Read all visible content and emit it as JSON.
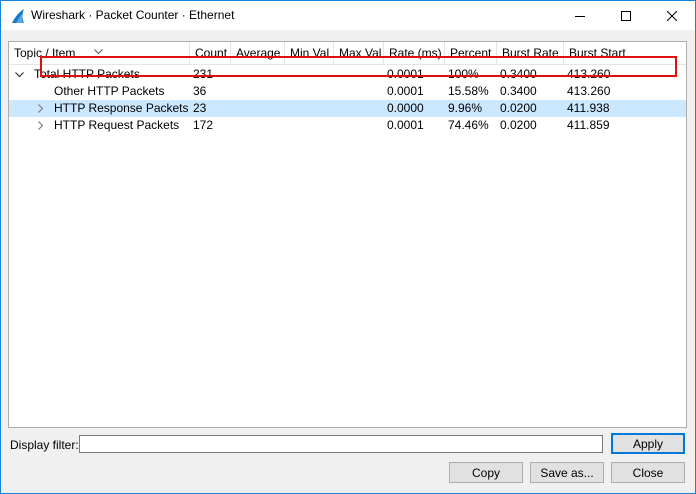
{
  "window": {
    "title": "Wireshark · Packet Counter · Ethernet",
    "accent": "#1883d7"
  },
  "tree": {
    "columns": [
      "Topic / Item",
      "Count",
      "Average",
      "Min Val",
      "Max Val",
      "Rate (ms)",
      "Percent",
      "Burst Rate",
      "Burst Start"
    ],
    "rows": [
      {
        "topic": "Total HTTP Packets",
        "count": "231",
        "average": "",
        "min": "",
        "max": "",
        "rate": "0.0001",
        "percent": "100%",
        "burst_rate": "0.3400",
        "burst_start": "413.260",
        "expander": "expanded"
      },
      {
        "topic": "Other HTTP Packets",
        "count": "36",
        "average": "",
        "min": "",
        "max": "",
        "rate": "0.0001",
        "percent": "15.58%",
        "burst_rate": "0.3400",
        "burst_start": "413.260",
        "expander": "none"
      },
      {
        "topic": "HTTP Response Packets",
        "count": "23",
        "average": "",
        "min": "",
        "max": "",
        "rate": "0.0000",
        "percent": "9.96%",
        "burst_rate": "0.0200",
        "burst_start": "411.938",
        "expander": "collapsed"
      },
      {
        "topic": "HTTP Request Packets",
        "count": "172",
        "average": "",
        "min": "",
        "max": "",
        "rate": "0.0001",
        "percent": "74.46%",
        "burst_rate": "0.0200",
        "burst_start": "411.859",
        "expander": "collapsed"
      }
    ],
    "selected_row": 2,
    "selection_color": "#cce8ff",
    "highlight_color": "#e01010"
  },
  "filter": {
    "label": "Display filter:",
    "value": "",
    "apply_label": "Apply"
  },
  "buttons": {
    "copy": "Copy",
    "save_as": "Save as...",
    "close": "Close"
  },
  "icons": {
    "app": "wireshark-fin-icon",
    "minimize": "minimize-icon",
    "maximize": "maximize-icon",
    "close": "close-icon"
  }
}
